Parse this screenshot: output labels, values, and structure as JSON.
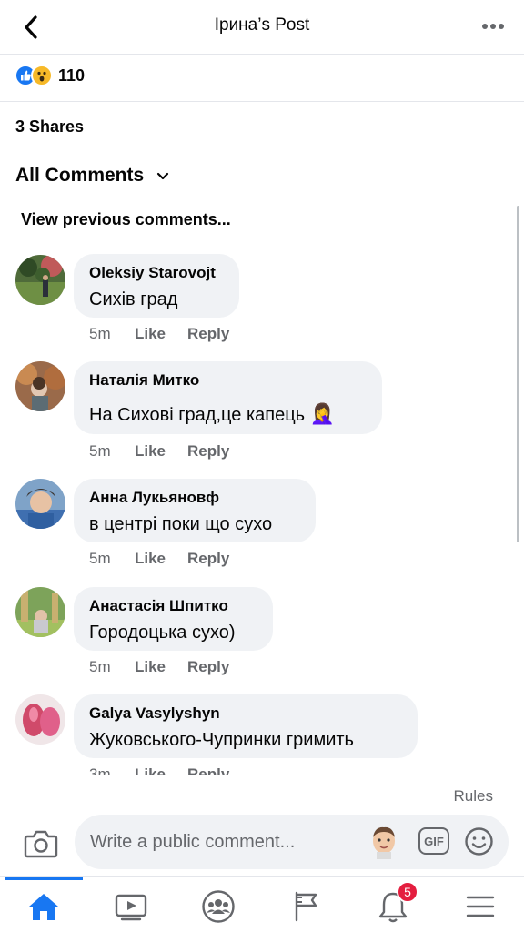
{
  "header": {
    "title": "Ірина’s Post"
  },
  "reactions": {
    "count": "110"
  },
  "shares": {
    "label": "3 Shares"
  },
  "comments_filter": {
    "label": "All Comments"
  },
  "view_previous": {
    "label": "View previous comments..."
  },
  "comments": [
    {
      "name": "Oleksiy Starovojt",
      "text": "Сихів град",
      "time": "5m",
      "like": "Like",
      "reply": "Reply"
    },
    {
      "name": "Наталія Митко",
      "text": "На Сихові град,це капець",
      "emoji": "🤦‍♀️",
      "time": "5m",
      "like": "Like",
      "reply": "Reply"
    },
    {
      "name": "Анна Лукьяновф",
      "text": "в центрі поки що сухо",
      "time": "5m",
      "like": "Like",
      "reply": "Reply"
    },
    {
      "name": "Анастасія Шпитко",
      "text": "Городоцька сухо)",
      "time": "5m",
      "like": "Like",
      "reply": "Reply"
    },
    {
      "name": "Galya Vasylyshyn",
      "text": "Жуковського-Чупринки гримить",
      "time": "3m",
      "like": "Like",
      "reply": "Reply"
    }
  ],
  "composer": {
    "rules": "Rules",
    "placeholder": "Write a public comment...",
    "gif": "GIF"
  },
  "tabbar": {
    "tabs": [
      "home-icon",
      "video-icon",
      "groups-icon",
      "pages-flag-icon",
      "notifications-bell-icon",
      "menu-icon"
    ],
    "notification_badge": "5"
  },
  "colors": {
    "accent": "#1877f2",
    "badge": "#e41e3f",
    "bubble": "#f0f2f5",
    "meta": "#65676b"
  }
}
